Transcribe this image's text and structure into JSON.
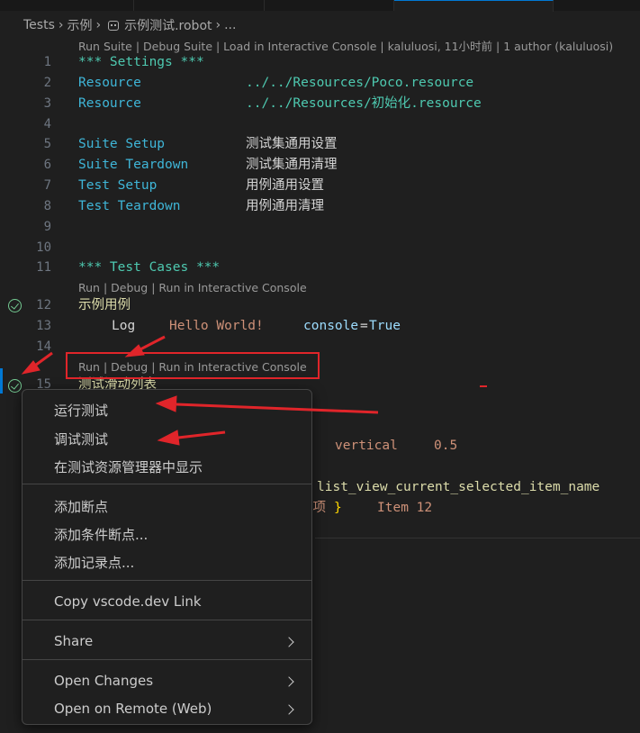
{
  "breadcrumb": {
    "parts": [
      "Tests",
      "示例",
      "示例测试.robot",
      "..."
    ]
  },
  "code_lens": {
    "suite": "Run Suite | Debug Suite | Load in Interactive Console | kaluluosi, 11小时前 | 1 author (kaluluosi)",
    "test1": "Run | Debug | Run in Interactive Console",
    "test2": "Run | Debug | Run in Interactive Console"
  },
  "lines": {
    "l1": {
      "no": "1",
      "text": "*** Settings ***"
    },
    "l2": {
      "no": "2",
      "key": "Resource",
      "value": "../../Resources/Poco.resource"
    },
    "l3": {
      "no": "3",
      "key": "Resource",
      "value": "../../Resources/初始化.resource"
    },
    "l4": {
      "no": "4"
    },
    "l5": {
      "no": "5",
      "key": "Suite Setup",
      "value": "测试集通用设置"
    },
    "l6": {
      "no": "6",
      "key": "Suite Teardown",
      "value": "测试集通用清理"
    },
    "l7": {
      "no": "7",
      "key": "Test Setup",
      "value": "用例通用设置"
    },
    "l8": {
      "no": "8",
      "key": "Test Teardown",
      "value": "用例通用清理"
    },
    "l9": {
      "no": "9"
    },
    "l10": {
      "no": "10"
    },
    "l11": {
      "no": "11",
      "text": "*** Test Cases ***"
    },
    "l12": {
      "no": "12",
      "text": "示例用例"
    },
    "l13": {
      "no": "13",
      "kw": "Log",
      "arg": "Hello World!",
      "param": "console",
      "eq": "=",
      "val": "True"
    },
    "l14": {
      "no": "14"
    },
    "l15": {
      "no": "15",
      "text": "测试滑动列表"
    },
    "hidden1": {
      "a": "vertical",
      "b": "0.5"
    },
    "hidden2": {
      "text": "list_view_current_selected_item_name"
    },
    "hidden3": {
      "a": "中项",
      "brace": "}",
      "b": "Item 12"
    }
  },
  "context_menu": {
    "run_test": "运行测试",
    "debug_test": "调试测试",
    "reveal_in_explorer": "在测试资源管理器中显示",
    "add_breakpoint": "添加断点",
    "add_conditional_breakpoint": "添加条件断点...",
    "add_logpoint": "添加记录点...",
    "copy_link": "Copy vscode.dev Link",
    "share": "Share",
    "open_changes": "Open Changes",
    "open_on_remote": "Open on Remote (Web)"
  },
  "colors": {
    "annotation_red": "#e0252a",
    "test_pass_green": "#73c991",
    "accent_blue": "#0078d4"
  }
}
